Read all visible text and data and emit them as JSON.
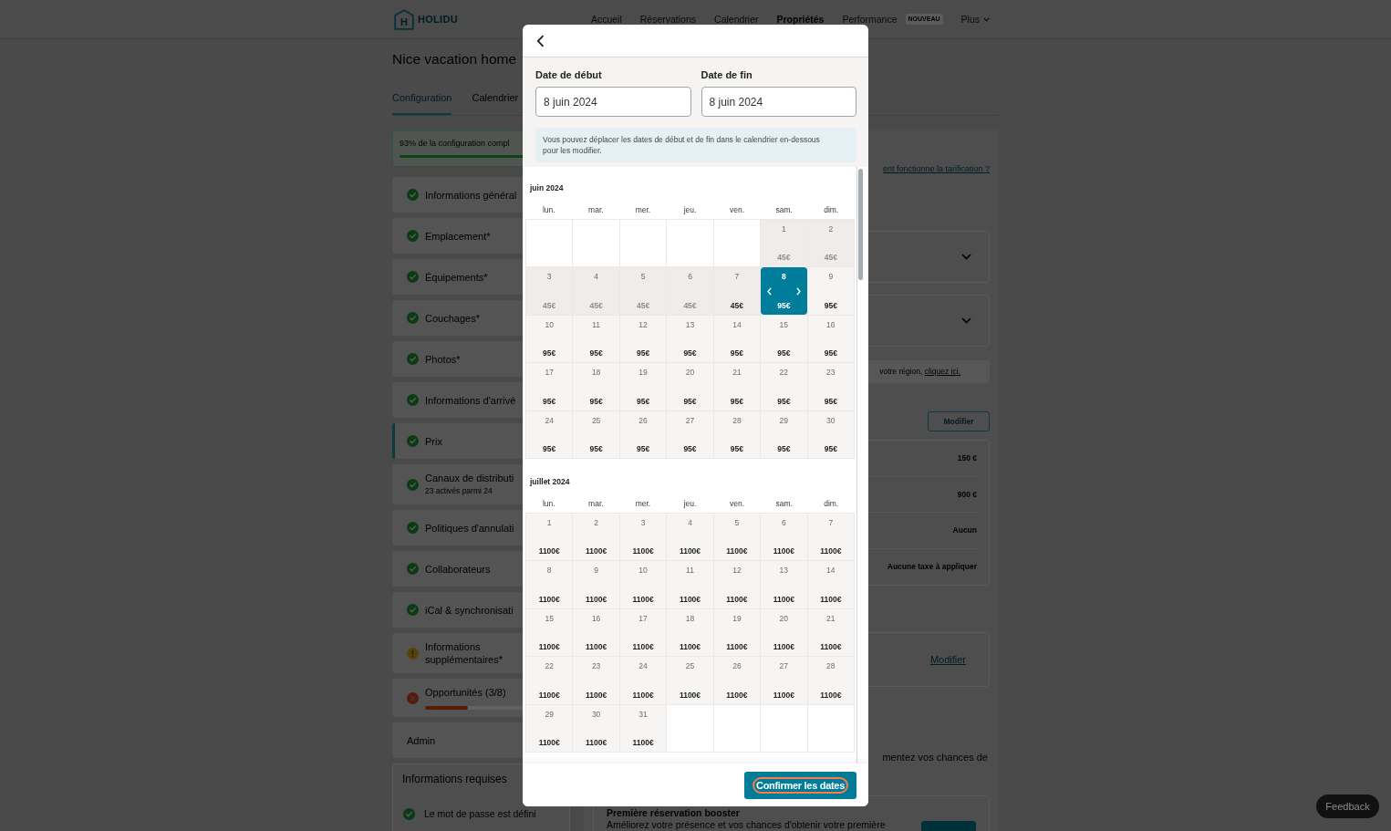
{
  "top_bar": {
    "logo_mark": "H",
    "brand": "HOLIDU",
    "nav": [
      {
        "label": "Accueil",
        "kind": "link",
        "selected": false
      },
      {
        "label": "Réservations",
        "kind": "link",
        "selected": false
      },
      {
        "label": "Calendrier",
        "kind": "link",
        "selected": false
      },
      {
        "label": "Propriétés",
        "kind": "link",
        "selected": true
      },
      {
        "label": "Performance",
        "kind": "link",
        "selected": false,
        "badge": "NOUVEAU"
      },
      {
        "label": "Plus",
        "kind": "menu",
        "selected": false
      }
    ]
  },
  "page": {
    "title": "Nice vacation home",
    "tabs": [
      {
        "label": "Configuration",
        "selected": true
      },
      {
        "label": "Calendrier",
        "selected": false
      }
    ]
  },
  "sidebar": {
    "progress": {
      "text": "93% de la configuration compl",
      "level": 0.93
    },
    "items": [
      {
        "label": "Informations général",
        "kind": "done",
        "selected": false
      },
      {
        "label": "Emplacement*",
        "kind": "done",
        "selected": false
      },
      {
        "label": "Équipements*",
        "kind": "done",
        "selected": false
      },
      {
        "label": "Couchages*",
        "kind": "done",
        "selected": false
      },
      {
        "label": "Photos*",
        "kind": "done",
        "selected": false
      },
      {
        "label": "Informations d'arrivé",
        "kind": "done",
        "selected": false
      },
      {
        "label": "Prix",
        "kind": "done",
        "selected": true
      },
      {
        "label": "Canaux de distributi",
        "caption": "23 activés parmi 24",
        "kind": "done",
        "selected": false
      },
      {
        "label": "Politiques d'annulati",
        "kind": "done",
        "selected": false
      },
      {
        "label": "Collaborateurs",
        "kind": "done",
        "selected": false
      },
      {
        "label": "iCal & synchronisati",
        "kind": "done",
        "selected": false
      },
      {
        "label": "Informations supplémentaires*",
        "kind": "warning",
        "selected": false
      },
      {
        "label": "Opportunités (3/8)",
        "kind": "error",
        "selected": false,
        "level": 0.375
      },
      {
        "label": "Admin",
        "kind": "plain",
        "selected": false
      }
    ],
    "required_info": {
      "title": "Informations requises",
      "items": [
        {
          "label": "Le mot de passe est défini",
          "kind": "done"
        }
      ]
    }
  },
  "content": {
    "help_link": "ent fonctionne la tarification ?",
    "dropdowns": [
      {
        "expanded": false
      },
      {
        "expanded": false
      }
    ],
    "region_note": {
      "text": "votre région,",
      "link": "cliquez ici."
    },
    "modify_button": "Modifier",
    "fees": [
      "150 €",
      "900 €",
      "Aucun",
      "Aucune taxe à appliquer"
    ],
    "link_card": {
      "link": "Modifier"
    },
    "intro": "mentez vos chances de",
    "booster": {
      "title": "Première réservation booster",
      "text": "Améliorez votre présence et vos chances d'obtenir votre première"
    }
  },
  "feedback": "Feedback",
  "modal": {
    "start_label": "Date de début",
    "start_value": "8 juin 2024",
    "end_label": "Date de fin",
    "end_value": "8 juin 2024",
    "hint": "Vous pouvez déplacer les dates de début et de fin dans le calendrier en-dessous pour les modifier.",
    "months": [
      {
        "title": "juin 2024",
        "weekdays": [
          "lun.",
          "mar.",
          "mer.",
          "jeu.",
          "ven.",
          "sam.",
          "dim."
        ],
        "weeks": [
          [
            {
              "kind": "empty",
              "selected": false
            },
            {
              "kind": "empty",
              "selected": false
            },
            {
              "kind": "empty",
              "selected": false
            },
            {
              "kind": "empty",
              "selected": false
            },
            {
              "kind": "empty",
              "selected": false
            },
            {
              "day": "1",
              "price": "45€",
              "kind": "past",
              "disabled": true,
              "selected": false
            },
            {
              "day": "2",
              "price": "45€",
              "kind": "past",
              "disabled": true,
              "selected": false
            }
          ],
          [
            {
              "day": "3",
              "price": "45€",
              "kind": "past",
              "disabled": true,
              "selected": false
            },
            {
              "day": "4",
              "price": "45€",
              "kind": "past",
              "disabled": true,
              "selected": false
            },
            {
              "day": "5",
              "price": "45€",
              "kind": "past",
              "disabled": true,
              "selected": false
            },
            {
              "day": "6",
              "price": "45€",
              "kind": "past",
              "disabled": true,
              "selected": false
            },
            {
              "day": "7",
              "price": "45€",
              "kind": "past",
              "disabled": false,
              "selected": false
            },
            {
              "day": "8",
              "price": "95€",
              "kind": "open",
              "disabled": false,
              "selected": true
            },
            {
              "day": "9",
              "price": "95€",
              "kind": "open",
              "disabled": false,
              "selected": false
            }
          ],
          [
            {
              "day": "10",
              "price": "95€",
              "kind": "open",
              "disabled": false,
              "selected": false
            },
            {
              "day": "11",
              "price": "95€",
              "kind": "open",
              "disabled": false,
              "selected": false
            },
            {
              "day": "12",
              "price": "95€",
              "kind": "open",
              "disabled": false,
              "selected": false
            },
            {
              "day": "13",
              "price": "95€",
              "kind": "open",
              "disabled": false,
              "selected": false
            },
            {
              "day": "14",
              "price": "95€",
              "kind": "open",
              "disabled": false,
              "selected": false
            },
            {
              "day": "15",
              "price": "95€",
              "kind": "open",
              "disabled": false,
              "selected": false
            },
            {
              "day": "16",
              "price": "95€",
              "kind": "open",
              "disabled": false,
              "selected": false
            }
          ],
          [
            {
              "day": "17",
              "price": "95€",
              "kind": "open",
              "disabled": false,
              "selected": false
            },
            {
              "day": "18",
              "price": "95€",
              "kind": "open",
              "disabled": false,
              "selected": false
            },
            {
              "day": "19",
              "price": "95€",
              "kind": "open",
              "disabled": false,
              "selected": false
            },
            {
              "day": "20",
              "price": "95€",
              "kind": "open",
              "disabled": false,
              "selected": false
            },
            {
              "day": "21",
              "price": "95€",
              "kind": "open",
              "disabled": false,
              "selected": false
            },
            {
              "day": "22",
              "price": "95€",
              "kind": "open",
              "disabled": false,
              "selected": false
            },
            {
              "day": "23",
              "price": "95€",
              "kind": "open",
              "disabled": false,
              "selected": false
            }
          ],
          [
            {
              "day": "24",
              "price": "95€",
              "kind": "open",
              "disabled": false,
              "selected": false
            },
            {
              "day": "25",
              "price": "95€",
              "kind": "open",
              "disabled": false,
              "selected": false
            },
            {
              "day": "26",
              "price": "95€",
              "kind": "open",
              "disabled": false,
              "selected": false
            },
            {
              "day": "27",
              "price": "95€",
              "kind": "open",
              "disabled": false,
              "selected": false
            },
            {
              "day": "28",
              "price": "95€",
              "kind": "open",
              "disabled": false,
              "selected": false
            },
            {
              "day": "29",
              "price": "95€",
              "kind": "open",
              "disabled": false,
              "selected": false
            },
            {
              "day": "30",
              "price": "95€",
              "kind": "open",
              "disabled": false,
              "selected": false
            }
          ]
        ]
      },
      {
        "title": "juillet 2024",
        "weekdays": [
          "lun.",
          "mar.",
          "mer.",
          "jeu.",
          "ven.",
          "sam.",
          "dim."
        ],
        "weeks": [
          [
            {
              "day": "1",
              "price": "1100€",
              "kind": "open",
              "disabled": false,
              "selected": false
            },
            {
              "day": "2",
              "price": "1100€",
              "kind": "open",
              "disabled": false,
              "selected": false
            },
            {
              "day": "3",
              "price": "1100€",
              "kind": "open",
              "disabled": false,
              "selected": false
            },
            {
              "day": "4",
              "price": "1100€",
              "kind": "open",
              "disabled": false,
              "selected": false
            },
            {
              "day": "5",
              "price": "1100€",
              "kind": "open",
              "disabled": false,
              "selected": false
            },
            {
              "day": "6",
              "price": "1100€",
              "kind": "open",
              "disabled": false,
              "selected": false
            },
            {
              "day": "7",
              "price": "1100€",
              "kind": "open",
              "disabled": false,
              "selected": false
            }
          ],
          [
            {
              "day": "8",
              "price": "1100€",
              "kind": "open",
              "disabled": false,
              "selected": false
            },
            {
              "day": "9",
              "price": "1100€",
              "kind": "open",
              "disabled": false,
              "selected": false
            },
            {
              "day": "10",
              "price": "1100€",
              "kind": "open",
              "disabled": false,
              "selected": false
            },
            {
              "day": "11",
              "price": "1100€",
              "kind": "open",
              "disabled": false,
              "selected": false
            },
            {
              "day": "12",
              "price": "1100€",
              "kind": "open",
              "disabled": false,
              "selected": false
            },
            {
              "day": "13",
              "price": "1100€",
              "kind": "open",
              "disabled": false,
              "selected": false
            },
            {
              "day": "14",
              "price": "1100€",
              "kind": "open",
              "disabled": false,
              "selected": false
            }
          ],
          [
            {
              "day": "15",
              "price": "1100€",
              "kind": "open",
              "disabled": false,
              "selected": false
            },
            {
              "day": "16",
              "price": "1100€",
              "kind": "open",
              "disabled": false,
              "selected": false
            },
            {
              "day": "17",
              "price": "1100€",
              "kind": "open",
              "disabled": false,
              "selected": false
            },
            {
              "day": "18",
              "price": "1100€",
              "kind": "open",
              "disabled": false,
              "selected": false
            },
            {
              "day": "19",
              "price": "1100€",
              "kind": "open",
              "disabled": false,
              "selected": false
            },
            {
              "day": "20",
              "price": "1100€",
              "kind": "open",
              "disabled": false,
              "selected": false
            },
            {
              "day": "21",
              "price": "1100€",
              "kind": "open",
              "disabled": false,
              "selected": false
            }
          ],
          [
            {
              "day": "22",
              "price": "1100€",
              "kind": "open",
              "disabled": false,
              "selected": false
            },
            {
              "day": "23",
              "price": "1100€",
              "kind": "open",
              "disabled": false,
              "selected": false
            },
            {
              "day": "24",
              "price": "1100€",
              "kind": "open",
              "disabled": false,
              "selected": false
            },
            {
              "day": "25",
              "price": "1100€",
              "kind": "open",
              "disabled": false,
              "selected": false
            },
            {
              "day": "26",
              "price": "1100€",
              "kind": "open",
              "disabled": false,
              "selected": false
            },
            {
              "day": "27",
              "price": "1100€",
              "kind": "open",
              "disabled": false,
              "selected": false
            },
            {
              "day": "28",
              "price": "1100€",
              "kind": "open",
              "disabled": false,
              "selected": false
            }
          ],
          [
            {
              "day": "29",
              "price": "1100€",
              "kind": "open",
              "disabled": false,
              "selected": false
            },
            {
              "day": "30",
              "price": "1100€",
              "kind": "open",
              "disabled": false,
              "selected": false
            },
            {
              "day": "31",
              "price": "1100€",
              "kind": "open",
              "disabled": false,
              "selected": false
            },
            {
              "kind": "empty",
              "selected": false
            },
            {
              "kind": "empty",
              "selected": false
            },
            {
              "kind": "empty",
              "selected": false
            },
            {
              "kind": "empty",
              "selected": false
            }
          ]
        ]
      }
    ],
    "confirm": "Confirmer les dates"
  }
}
